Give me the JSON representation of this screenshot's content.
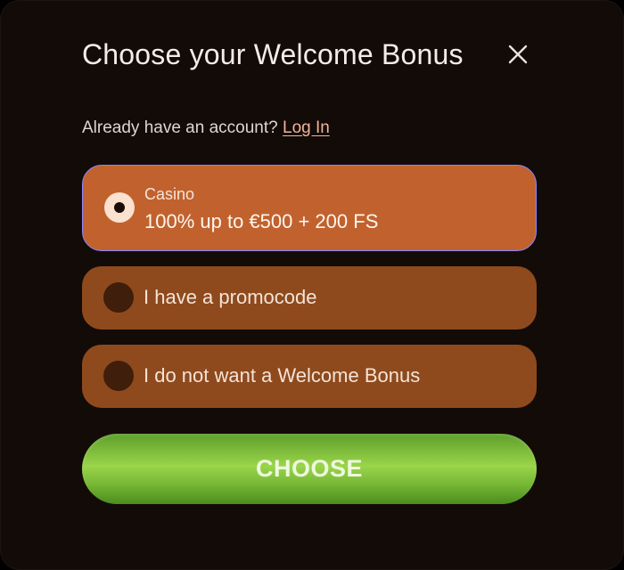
{
  "dialog": {
    "title": "Choose your Welcome Bonus",
    "close_icon": "close-icon"
  },
  "account": {
    "prompt": "Already have an account?",
    "login_link": "Log In"
  },
  "options": [
    {
      "sublabel": "Casino",
      "label": "100% up to €500 + 200 FS",
      "selected": true
    },
    {
      "label": "I have a promocode",
      "selected": false
    },
    {
      "label": "I do not want a Welcome Bonus",
      "selected": false
    }
  ],
  "actions": {
    "choose_label": "CHOOSE"
  },
  "colors": {
    "background": "#130b08",
    "selected_option": "#c1622e",
    "option": "#8e4a1d",
    "selected_border": "#8f86ff",
    "button": "#86c63e",
    "link": "#f0b49a"
  }
}
